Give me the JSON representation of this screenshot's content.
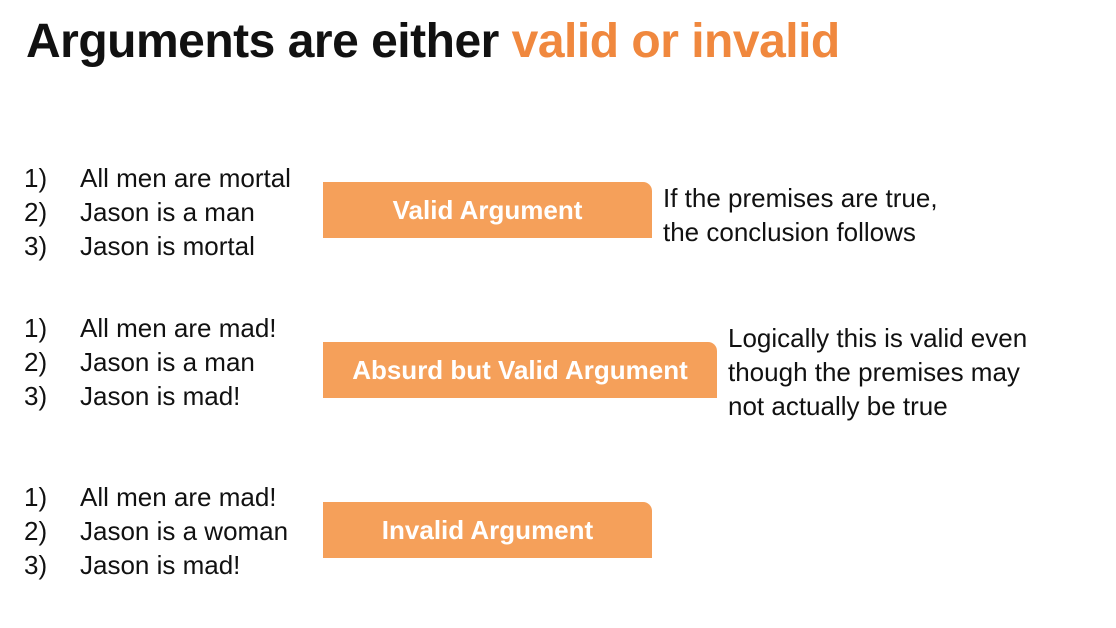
{
  "title": {
    "prefix": "Arguments are either ",
    "highlight": "valid or invalid"
  },
  "colors": {
    "accent": "#F0883E",
    "box": "#F5A05A"
  },
  "groups": [
    {
      "items": [
        {
          "num": "1)",
          "text": "All men are mortal"
        },
        {
          "num": "2)",
          "text": "Jason is a man"
        },
        {
          "num": "3)",
          "text": "Jason is mortal"
        }
      ],
      "label": "Valid Argument",
      "note": [
        "If the premises are true,",
        "the conclusion follows"
      ]
    },
    {
      "items": [
        {
          "num": "1)",
          "text": "All men are mad!"
        },
        {
          "num": "2)",
          "text": "Jason is a man"
        },
        {
          "num": "3)",
          "text": "Jason is mad!"
        }
      ],
      "label": "Absurd but Valid Argument",
      "note": [
        "Logically this is valid even",
        "though the premises may",
        "not actually be true"
      ]
    },
    {
      "items": [
        {
          "num": "1)",
          "text": "All men are mad!"
        },
        {
          "num": "2)",
          "text": "Jason is a woman"
        },
        {
          "num": "3)",
          "text": "Jason is mad!"
        }
      ],
      "label": "Invalid Argument"
    }
  ]
}
